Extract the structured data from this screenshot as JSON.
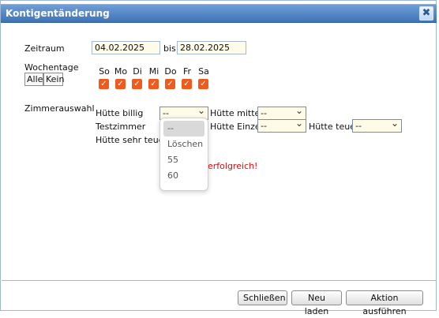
{
  "window": {
    "title": "Kontigentänderung",
    "close_glyph": "✖"
  },
  "form": {
    "zeitraum_label": "Zeitraum",
    "from_date": "04.02.2025",
    "bis_label": "bis",
    "to_date": "28.02.2025",
    "wochentage_label": "Wochentage",
    "all_button": "Alle",
    "none_button": "Kein",
    "days": [
      {
        "label": "So",
        "checked": true
      },
      {
        "label": "Mo",
        "checked": true
      },
      {
        "label": "Di",
        "checked": true
      },
      {
        "label": "Mi",
        "checked": true
      },
      {
        "label": "Do",
        "checked": true
      },
      {
        "label": "Fr",
        "checked": true
      },
      {
        "label": "Sa",
        "checked": true
      }
    ],
    "zimmerauswahl_label": "Zimmerauswahl",
    "rooms": [
      {
        "label": "Hütte billig",
        "value": "--"
      },
      {
        "label": "Hütte mittel",
        "value": "--"
      },
      {
        "label": "Testzimmer",
        "value": ""
      },
      {
        "label": "Hütte Einzel",
        "value": "--"
      },
      {
        "label": "Hütte teuer",
        "value": "--"
      },
      {
        "label": "Hütte sehr teuer",
        "value": ""
      }
    ],
    "dropdown_options": [
      "--",
      "Löschen",
      "55",
      "60"
    ],
    "success_message": "erfolgreich!"
  },
  "footer": {
    "close_label": "Schließen",
    "reload_label": "Neu laden",
    "execute_label": "Aktion ausführen"
  },
  "colors": {
    "titlebar": "#4f83c4",
    "checkbox": "#ef5a1f",
    "message": "#d20f0f"
  }
}
